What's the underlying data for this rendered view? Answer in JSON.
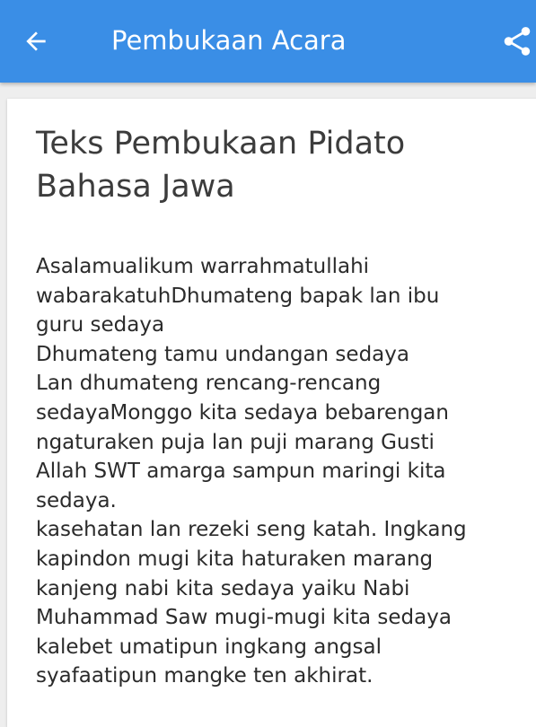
{
  "app_bar": {
    "title": "Pembukaan Acara",
    "back_icon": "arrow-left-icon",
    "share_icon": "share-icon",
    "color": "#3a8ee6"
  },
  "article": {
    "title": "Teks Pembukaan Pidato\nBahasa Jawa",
    "body": "Asalamualikum warrahmatullahi\nwabarakatuhDhumateng bapak lan ibu\nguru sedaya\nDhumateng tamu undangan sedaya\nLan dhumateng rencang-rencang\nsedayaMonggo kita sedaya bebarengan\nngaturaken puja lan puji marang Gusti\nAllah SWT amarga sampun maringi kita\nsedaya.\nkasehatan lan rezeki seng katah. Ingkang\nkapindon mugi kita haturaken marang\nkanjeng nabi kita sedaya yaiku Nabi\nMuhammad Saw mugi-mugi kita sedaya\nkalebet umatipun ingkang angsal\nsyafaatipun mangke ten akhirat."
  }
}
